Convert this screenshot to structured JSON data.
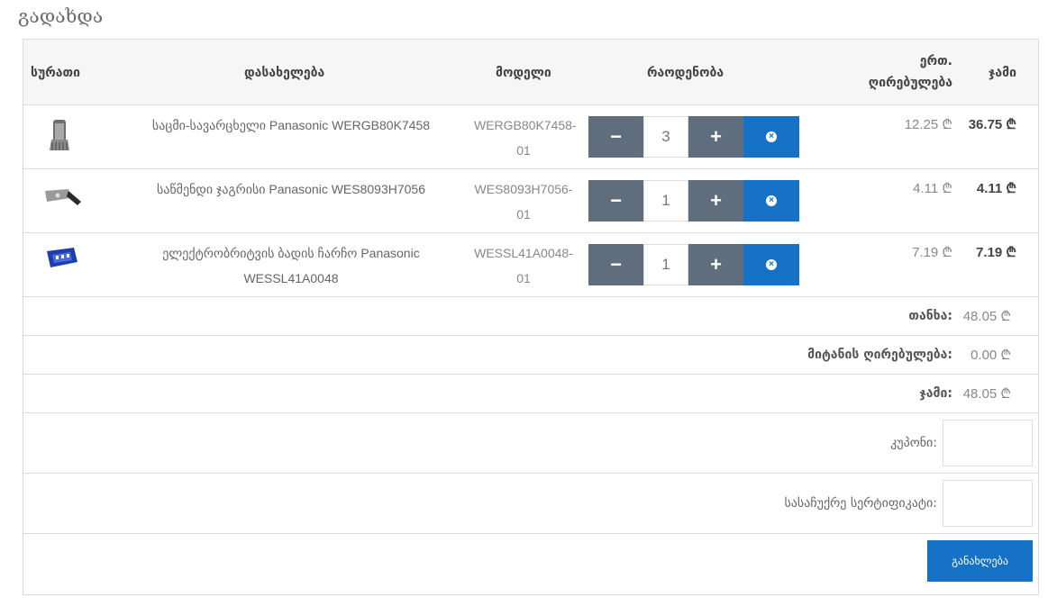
{
  "page": {
    "title": "გადახდა"
  },
  "table": {
    "headers": {
      "image": "სურათი",
      "name": "დასახელება",
      "model": "მოდელი",
      "quantity": "რაოდენობა",
      "unit_price_1": "ერთ.",
      "unit_price_2": "ღირებულება",
      "total": "ჯამი"
    },
    "items": [
      {
        "name": "საცმი-სავარცხელი Panasonic WERGB80K7458",
        "model": "WERGB80K7458-01",
        "quantity": "3",
        "unit_price": "12.25 ₾",
        "total": "36.75 ₾",
        "image_icon": "hair-clipper-comb-icon"
      },
      {
        "name": "საწმენდი ჯაგრისი Panasonic WES8093H7056",
        "model": "WES8093H7056-01",
        "quantity": "1",
        "unit_price": "4.11 ₾",
        "total": "4.11 ₾",
        "image_icon": "cleaning-brush-icon"
      },
      {
        "name": "ელექტრობრიტვის ბადის ჩარჩო Panasonic WESSL41A0048",
        "model": "WESSL41A0048-01",
        "quantity": "1",
        "unit_price": "7.19 ₾",
        "total": "7.19 ₾",
        "image_icon": "shaver-frame-icon"
      }
    ],
    "buttons": {
      "minus": "−",
      "plus": "+",
      "remove": "×"
    }
  },
  "summary": {
    "subtotal_label": "თანხა:",
    "subtotal_value": "48.05 ₾",
    "shipping_label": "მიტანის ღირებულება:",
    "shipping_value": "0.00 ₾",
    "total_label": "ჯამი:",
    "total_value": "48.05 ₾"
  },
  "coupon": {
    "label": "კუპონი:",
    "value": ""
  },
  "voucher": {
    "label": "სასაჩუქრე სერტიფიკატი:",
    "value": ""
  },
  "actions": {
    "update_label": "განახლება"
  },
  "colors": {
    "primary": "#1672c7",
    "secondary": "#5f6d7c",
    "border": "#dcdcdc",
    "header_bg": "#f6f6f6"
  }
}
